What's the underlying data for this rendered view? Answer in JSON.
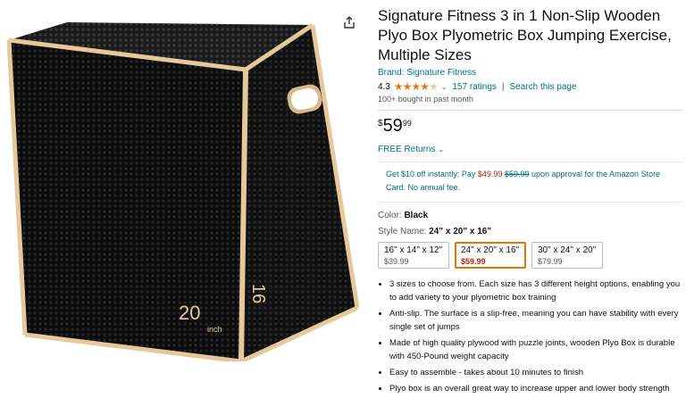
{
  "product": {
    "title": "Signature Fitness 3 in 1 Non-Slip Wooden Plyo Box Plyometric Box Jumping Exercise, Multiple Sizes",
    "brand": "Brand: Signature Fitness",
    "rating": "4.3",
    "ratings_count": "157 ratings",
    "search_page": "Search this page",
    "bought": "100+ bought in past month",
    "price_symbol": "$",
    "price_whole": "59",
    "price_fraction": "99",
    "returns": "FREE Returns",
    "promo_prefix": "Get $10 off instantly: Pay ",
    "promo_price": "$49.99",
    "promo_old": "$59.99",
    "promo_suffix": " upon approval for the Amazon Store Card. No annual fee.",
    "color_label": "Color: ",
    "color_value": "Black",
    "style_label": "Style Name: ",
    "style_value": "24\" x 20\" x 16\"",
    "box_label_20": "20",
    "box_label_inch": "inch",
    "box_label_16": "16"
  },
  "sizes": [
    {
      "label": "16\" x 14\" x 12\"",
      "price": "$39.99"
    },
    {
      "label": "24\" x 20\" x 16\"",
      "price": "$59.99"
    },
    {
      "label": "30\" x 24\" x 20\"",
      "price": "$79.99"
    }
  ],
  "bullets": [
    "3 sizes to choose from. Each size has 3 different height options, enabling you to add variety to your plyometric box training",
    "Anti-slip. The surface is a slip-free, meaning you can have stability with every single set of jumps",
    "Made of high quality plywood with puzzle joints, wooden Plyo Box is durable with 450-Pound weight capacity",
    "Easy to assemble - takes about 10 minutes to finish",
    "Plyo box is an overall great way to increase upper and lower body strength"
  ],
  "colors": {
    "link": "#007185",
    "star": "#de7921",
    "selected_border": "#e77600",
    "deal": "#b12704"
  }
}
